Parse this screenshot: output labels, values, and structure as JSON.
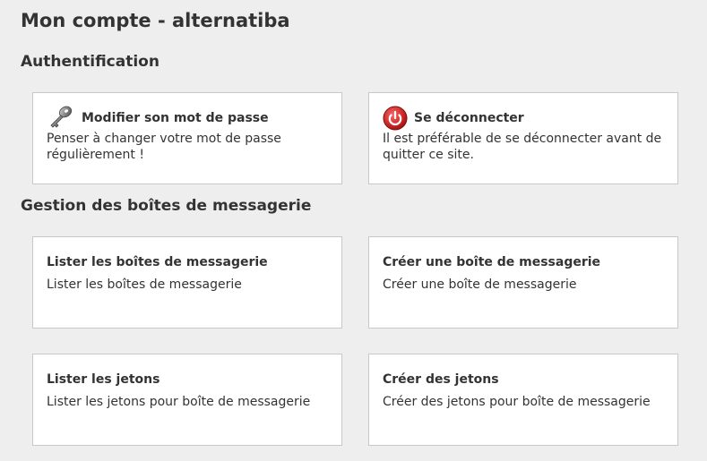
{
  "page": {
    "title": "Mon compte - alternatiba"
  },
  "sections": [
    {
      "title": "Authentification",
      "cards": [
        {
          "icon": "key-icon",
          "title": "Modifier son mot de passe",
          "description": "Penser à changer votre mot de passe régulièrement !"
        },
        {
          "icon": "power-icon",
          "title": "Se déconnecter",
          "description": "Il est préférable de se déconnecter avant de quitter ce site."
        }
      ]
    },
    {
      "title": "Gestion des boîtes de messagerie",
      "cards": [
        {
          "title": "Lister les boîtes de messagerie",
          "description": "Lister les boîtes de messagerie"
        },
        {
          "title": "Créer une boîte de messagerie",
          "description": "Créer une boîte de messagerie"
        },
        {
          "title": "Lister les jetons",
          "description": "Lister les jetons pour boîte de messagerie"
        },
        {
          "title": "Créer des jetons",
          "description": "Créer des jetons pour boîte de messagerie"
        }
      ]
    }
  ],
  "colors": {
    "background": "#eeeeee",
    "card_background": "#ffffff",
    "card_border": "#c8c8c8",
    "text": "#333333",
    "power_red": "#cc2222"
  }
}
